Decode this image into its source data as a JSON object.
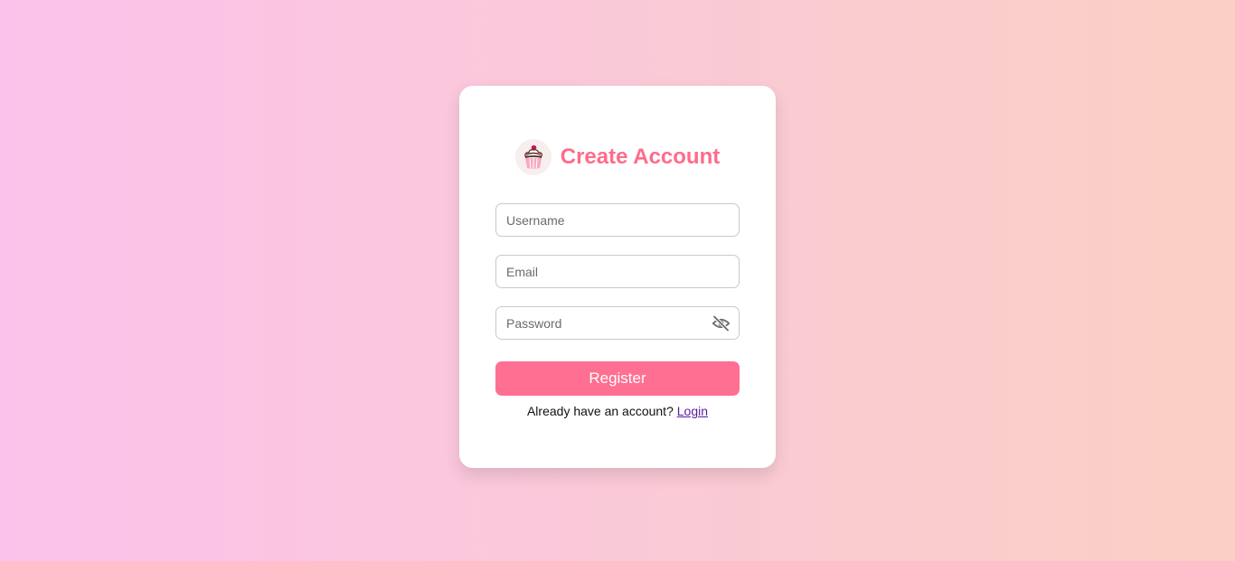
{
  "form": {
    "title": "Create Account",
    "username_placeholder": "Username",
    "email_placeholder": "Email",
    "password_placeholder": "Password",
    "register_label": "Register",
    "footer_text": "Already have an account?",
    "login_link": "Login"
  },
  "icons": {
    "logo": "cupcake-icon",
    "password_toggle": "eye-slash-icon"
  },
  "colors": {
    "accent": "#ff6b8b",
    "button": "#ff6f91",
    "background_start": "#fbc2eb",
    "background_end": "#fad0c4",
    "link": "#5a1aa0"
  }
}
